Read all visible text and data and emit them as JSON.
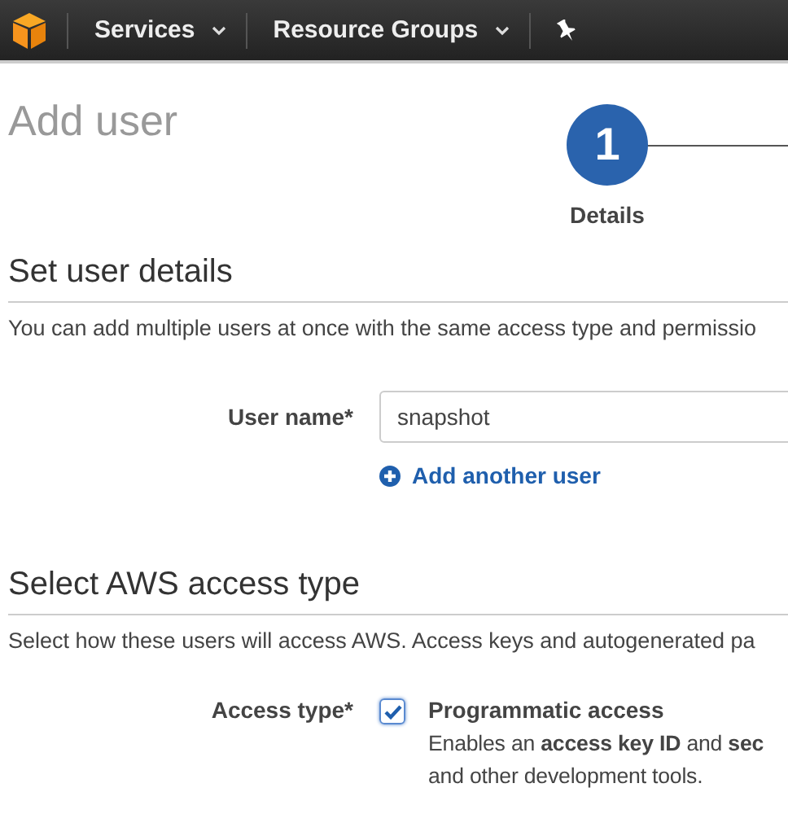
{
  "nav": {
    "items": [
      {
        "label": "Services",
        "kind": "dropdown"
      },
      {
        "label": "Resource Groups",
        "kind": "dropdown"
      },
      {
        "kind": "pin"
      }
    ]
  },
  "page": {
    "title": "Add user"
  },
  "steps": [
    {
      "number": "1",
      "label": "Details",
      "selected": true
    }
  ],
  "user_details": {
    "heading": "Set user details",
    "description": "You can add multiple users at once with the same access type and permissio",
    "user_name": {
      "label": "User name*",
      "value": "snapshot"
    },
    "add_link": "Add another user"
  },
  "access_type": {
    "heading": "Select AWS access type",
    "description": "Select how these users will access AWS. Access keys and autogenerated pa",
    "label": "Access type*",
    "options": [
      {
        "title": "Programmatic access",
        "checked": true,
        "description": "Enables an **access key ID** and **sec**",
        "description_2": "and other development tools."
      }
    ]
  }
}
